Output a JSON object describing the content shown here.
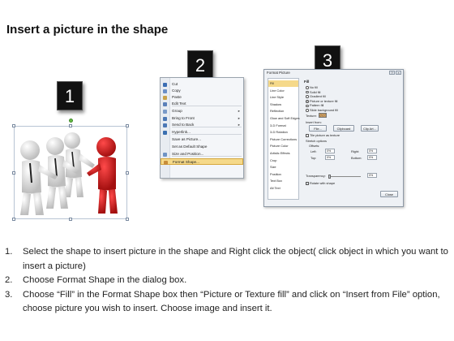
{
  "title": "Insert a picture in the shape",
  "step_badges": [
    "1",
    "2",
    "3"
  ],
  "context_menu": {
    "items": [
      {
        "label": "Cut",
        "icon": "scissors-icon",
        "color": "#3b6db3"
      },
      {
        "label": "Copy",
        "icon": "copy-icon",
        "color": "#6a8fc8"
      },
      {
        "label": "Paste",
        "icon": "clipboard-icon",
        "color": "#c9a24a"
      },
      {
        "label": "Edit Text",
        "icon": "edit-text-icon",
        "color": "#5a7fb8"
      },
      {
        "label": "Group",
        "icon": "group-icon",
        "color": "#7a9ac8",
        "submenu": true
      },
      {
        "label": "Bring to Front",
        "icon": "bring-front-icon",
        "color": "#4c78b5",
        "submenu": true
      },
      {
        "label": "Send to Back",
        "icon": "send-back-icon",
        "color": "#4c78b5",
        "submenu": true
      },
      {
        "label": "Hyperlink...",
        "icon": "hyperlink-icon",
        "color": "#3a6fb0"
      },
      {
        "label": "Save as Picture...",
        "icon": "",
        "color": ""
      },
      {
        "label": "Set as Default Shape",
        "icon": "",
        "color": ""
      },
      {
        "label": "Size and Position...",
        "icon": "size-position-icon",
        "color": "#6f93c4"
      },
      {
        "label": "Format Shape...",
        "icon": "format-shape-icon",
        "color": "#c88d3a",
        "highlighted": true
      }
    ]
  },
  "dialog": {
    "title": "Format Picture",
    "nav": [
      "Fill",
      "Line Color",
      "Line Style",
      "Shadow",
      "Reflection",
      "Glow and Soft Edges",
      "3-D Format",
      "3-D Rotation",
      "Picture Corrections",
      "Picture Color",
      "Artistic Effects",
      "Crop",
      "Size",
      "Position",
      "Text Box",
      "Alt Text"
    ],
    "section_title": "Fill",
    "fill_options": [
      "No fill",
      "Solid fill",
      "Gradient fill",
      "Picture or texture fill",
      "Pattern fill",
      "Slide background fill"
    ],
    "texture_label": "Texture:",
    "insert_from_label": "Insert from:",
    "buttons": {
      "file": "File...",
      "clipboard": "Clipboard",
      "clip_art": "Clip Art...",
      "close": "Close"
    },
    "tile_option": "Tile picture as texture",
    "stretch_label": "Stretch options",
    "offsets_label": "Offsets:",
    "offsets": [
      {
        "label": "Left:",
        "value": "0%"
      },
      {
        "label": "Right:",
        "value": "0%"
      },
      {
        "label": "Top:",
        "value": "0%"
      },
      {
        "label": "Bottom:",
        "value": "0%"
      }
    ],
    "transparency_label": "Transparency:",
    "transparency_value": "0%",
    "rotate_option": "Rotate with shape"
  },
  "instructions": [
    {
      "num": "1.",
      "text": "Select the shape to insert picture in the shape and Right click the object( click object in which you want to insert a picture)"
    },
    {
      "num": "2.",
      "text": "Choose Format Shape in the dialog box."
    },
    {
      "num": "3.",
      "text": "Choose “Fill” in the Format Shape box then “Picture or Texture fill”  and click on “Insert from File” option, choose picture you wish to insert. Choose image and insert it."
    }
  ],
  "colors": {
    "figure_white": "#f2f2f2",
    "figure_red": "#cc1f1f",
    "selection_border": "#b8c4d4",
    "handle_green": "#66bb44",
    "menu_highlight": "#f5d98a"
  }
}
